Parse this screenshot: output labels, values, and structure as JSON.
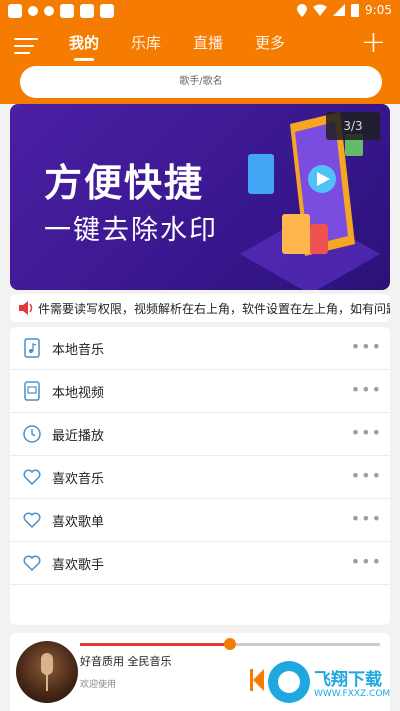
{
  "status_bar": {
    "time": "9:05"
  },
  "header": {
    "tabs": [
      {
        "label": "我的",
        "active": true
      },
      {
        "label": "乐库",
        "active": false
      },
      {
        "label": "直播",
        "active": false
      },
      {
        "label": "更多",
        "active": false
      }
    ],
    "add_icon": "plus-icon",
    "menu_icon": "menu-icon"
  },
  "search": {
    "placeholder": "歌手/歌名"
  },
  "banner": {
    "title": "方便快捷",
    "subtitle": "一键去除水印",
    "counter": "3/3"
  },
  "notice": {
    "text": "件需要读写权限，视频解析在右上角，软件设置在左上角，如有问题"
  },
  "menu_list": [
    {
      "label": "本地音乐",
      "icon": "music-file-icon"
    },
    {
      "label": "本地视频",
      "icon": "video-file-icon"
    },
    {
      "label": "最近播放",
      "icon": "clock-icon"
    },
    {
      "label": "喜欢音乐",
      "icon": "heart-icon"
    },
    {
      "label": "喜欢歌单",
      "icon": "heart-icon"
    },
    {
      "label": "喜欢歌手",
      "icon": "heart-icon"
    }
  ],
  "player": {
    "song_title": "好音质用 全民音乐",
    "artist": "欢迎使用",
    "progress": 0.5
  },
  "watermark": {
    "name": "飞翔下载",
    "url": "WWW.FXXZ.COM"
  },
  "colors": {
    "accent": "#f57c00",
    "icon_blue": "#4a90c8",
    "progress_red": "#e53935"
  }
}
